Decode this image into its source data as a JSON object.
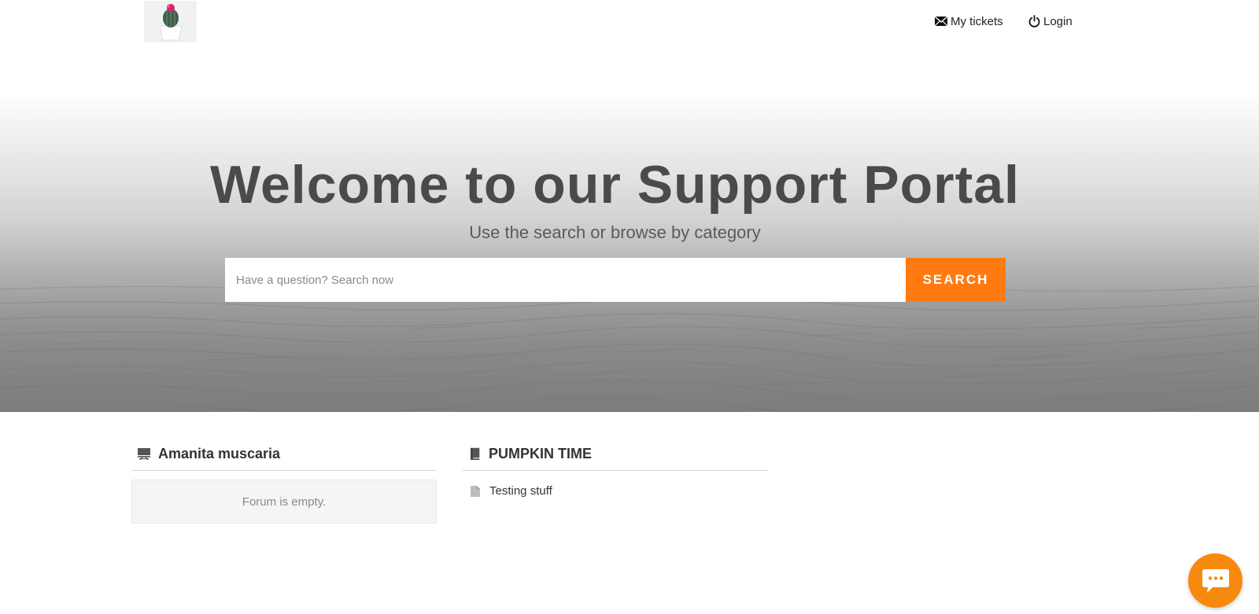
{
  "header": {
    "logo_alt": "cactus logo",
    "nav": {
      "my_tickets": "My tickets",
      "login": "Login"
    }
  },
  "hero": {
    "title": "Welcome to our Support Portal",
    "subtitle": "Use the search or browse by category",
    "search": {
      "placeholder": "Have a question? Search now",
      "value": "",
      "button_label": "SEARCH"
    }
  },
  "categories": [
    {
      "title": "Amanita muscaria",
      "icon": "forum-icon",
      "empty_message": "Forum is empty."
    },
    {
      "title": "PUMPKIN TIME",
      "icon": "book-icon",
      "articles": [
        {
          "title": "Testing stuff",
          "icon": "document-icon"
        }
      ]
    }
  ],
  "chat": {
    "icon": "chat-bubble-icon"
  },
  "colors": {
    "accent": "#ff7b12",
    "chat": "#f7890f",
    "title_text": "#4a4a4a"
  }
}
